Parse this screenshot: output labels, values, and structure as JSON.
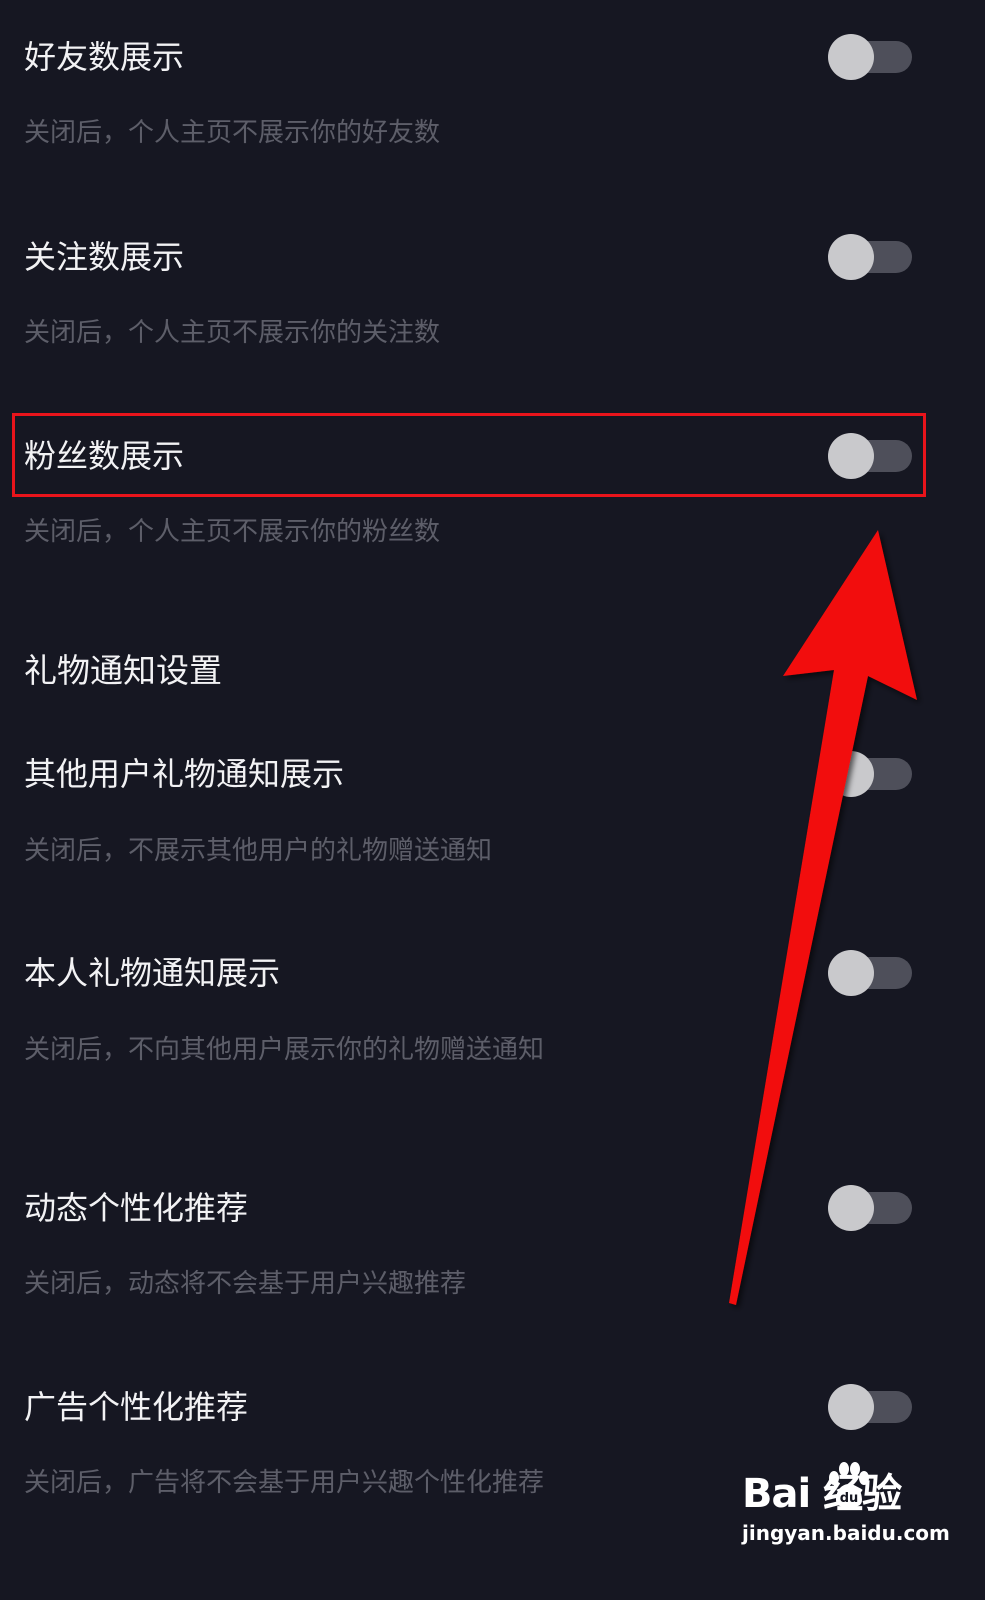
{
  "settings": [
    {
      "title": "好友数展示",
      "desc": "关闭后，个人主页不展示你的好友数",
      "enabled": false
    },
    {
      "title": "关注数展示",
      "desc": "关闭后，个人主页不展示你的关注数",
      "enabled": false
    },
    {
      "title": "粉丝数展示",
      "desc": "关闭后，个人主页不展示你的粉丝数",
      "enabled": false
    },
    {
      "title": "其他用户礼物通知展示",
      "desc": "关闭后，不展示其他用户的礼物赠送通知",
      "enabled": false
    },
    {
      "title": "本人礼物通知展示",
      "desc": "关闭后，不向其他用户展示你的礼物赠送通知",
      "enabled": false
    },
    {
      "title": "动态个性化推荐",
      "desc": "关闭后，动态将不会基于用户兴趣推荐",
      "enabled": false
    },
    {
      "title": "广告个性化推荐",
      "desc": "关闭后，广告将不会基于用户兴趣个性化推荐",
      "enabled": false
    }
  ],
  "section": {
    "gift_title": "礼物通知设置"
  },
  "watermark": {
    "logo_text": "Bai  经验",
    "url": "jingyan.baidu.com"
  },
  "colors": {
    "background": "#161722",
    "title_text": "#f2f2f4",
    "desc_text": "#5d5e69",
    "toggle_track": "#4e4f5a",
    "toggle_knob": "#c9c9cc",
    "annotation_red": "#e8141b"
  },
  "icons": {
    "annotation_arrow": "arrow-up-icon",
    "watermark": "baidu-paw-icon"
  }
}
